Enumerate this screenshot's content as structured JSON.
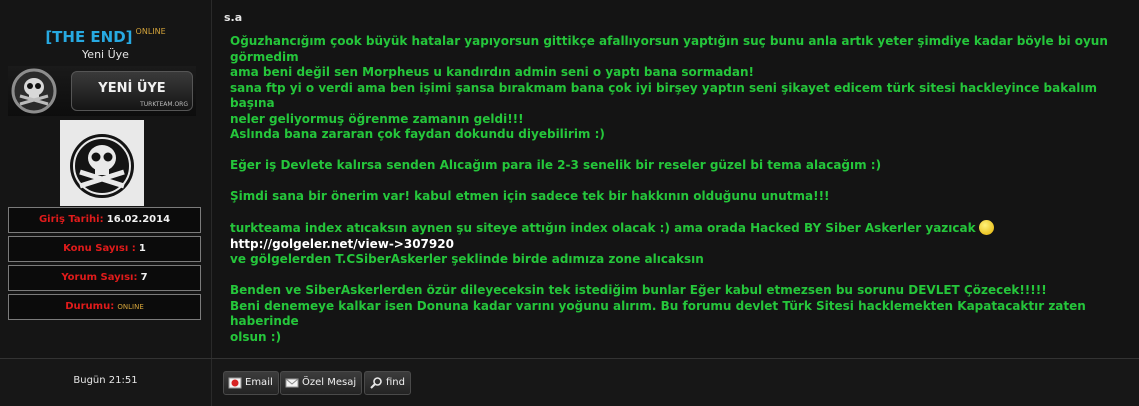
{
  "author": {
    "username": "[THE END]",
    "status": "ONLINE",
    "title": "Yeni Üye",
    "rank_label": "YENİ ÜYE",
    "rank_site": "TURKTEAM.ORG"
  },
  "stats": [
    {
      "label": "Giriş Tarihi:",
      "value": "16.02.2014"
    },
    {
      "label": "Konu Sayısı :",
      "value": "1"
    },
    {
      "label": "Yorum Sayısı:",
      "value": "7"
    },
    {
      "label": "Durumu:",
      "value": "ONLINE"
    }
  ],
  "post": {
    "title": "s.a",
    "lines": [
      "Oğuzhancığım çook büyük hatalar yapıyorsun gittikçe afallıyorsun yaptığın suç bunu anla artık yeter şimdiye kadar böyle bi oyun görmedim",
      "ama beni değil sen Morpheus u kandırdın admin seni o yaptı bana sormadan!",
      "sana ftp yi o verdi ama ben işimi şansa bırakmam bana çok iyi birşey yaptın seni şikayet edicem türk sitesi hackleyince bakalım başına",
      "neler geliyormuş öğrenme zamanın geldi!!!",
      "Aslında bana zararan çok faydan dokundu diyebilirim :)",
      "",
      "Eğer iş Devlete kalırsa senden Alıcağım para ile 2-3 senelik bir reseler güzel bi tema alacağım :)",
      "",
      "Şimdi sana bir önerim var! kabul etmen için sadece tek bir hakkının olduğunu unutma!!!",
      "",
      "turkteama index atıcaksın aynen şu siteye attığın index olacak :) ama orada Hacked BY Siber Askerler yazıcak"
    ],
    "link": "http://golgeler.net/view->307920",
    "lines2": [
      "ve gölgelerden T.CSiberAskerler şeklinde birde adımıza zone alıcaksın",
      "",
      "Benden ve SiberAskerlerden özür dileyeceksin tek istediğim bunlar Eğer kabul etmezsen bu sorunu DEVLET Çözecek!!!!!",
      "Beni denemeye kalkar isen Donuna kadar varını yoğunu alırım. Bu forumu devlet Türk Sitesi hacklemekten Kapatacaktır zaten haberinde",
      "olsun :)"
    ]
  },
  "footer": {
    "date": "Bugün 21:51",
    "buttons": [
      {
        "label": "Email",
        "icon": "email-icon"
      },
      {
        "label": "Özel Mesaj",
        "icon": "envelope-icon"
      },
      {
        "label": "find",
        "icon": "magnifier-icon"
      }
    ]
  },
  "colors": {
    "post_text": "#25c63b",
    "username": "#27a9e1",
    "stat_label": "#e01b1b",
    "online": "#d2a23a"
  }
}
